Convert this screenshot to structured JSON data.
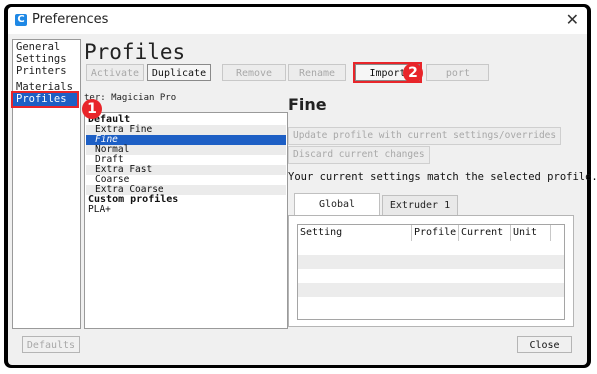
{
  "window": {
    "title": "Preferences",
    "icon": "app-icon"
  },
  "sidebar": {
    "items": [
      {
        "label": "General"
      },
      {
        "label": "Settings"
      },
      {
        "label": "Printers"
      },
      {
        "label": "Materials"
      },
      {
        "label": "Profiles"
      }
    ]
  },
  "main": {
    "title": "Profiles",
    "toolbar": {
      "activate": "Activate",
      "duplicate": "Duplicate",
      "remove": "Remove",
      "rename": "Rename",
      "import": "Import",
      "export": "port"
    },
    "filter": "ter: Magician Pro",
    "profiles": {
      "default_group": "Default",
      "default_items": [
        "Extra Fine",
        "Fine",
        "Normal",
        "Draft",
        "Extra Fast",
        "Coarse",
        "Extra Coarse"
      ],
      "custom_group": "Custom profiles",
      "custom_items": [
        "PLA+"
      ]
    }
  },
  "detail": {
    "name": "Fine",
    "update_button": "Update profile with current settings/overrides",
    "discard_button": "Discard current changes",
    "message": "Your current settings match the selected profile.",
    "tabs": [
      "Global Settings",
      "Extruder 1"
    ],
    "table_headers": [
      "Setting",
      "Profile",
      "Current",
      "Unit"
    ]
  },
  "footer": {
    "defaults": "Defaults",
    "close": "Close"
  },
  "annotations": [
    "1",
    "2"
  ],
  "colors": {
    "selection": "#1d5fc5",
    "annotation": "#e8252a"
  }
}
